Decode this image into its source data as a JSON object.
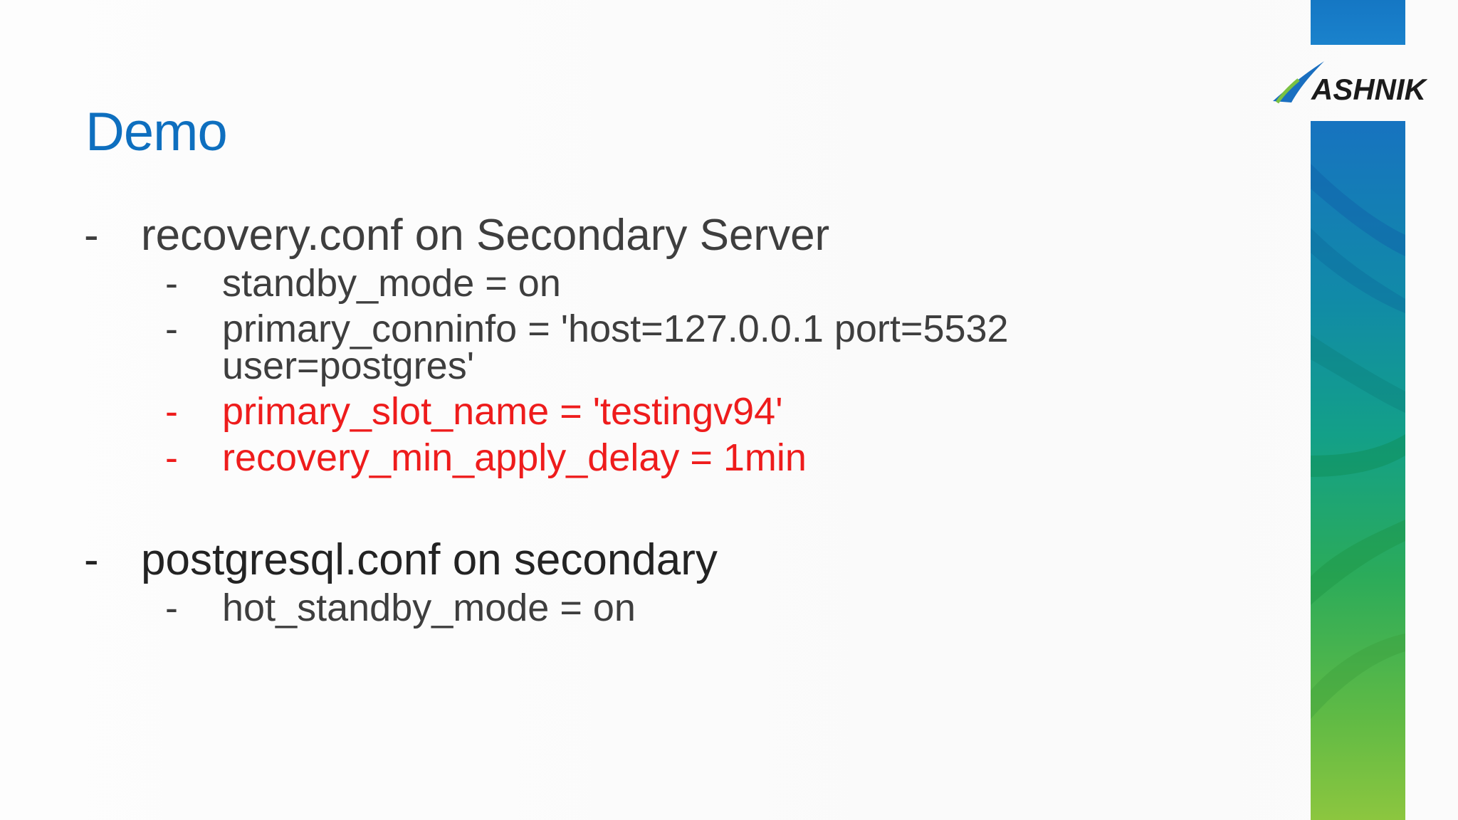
{
  "slide": {
    "title": "Demo",
    "logo_text": "ASHNIK",
    "colors": {
      "title": "#0e6fbf",
      "body_text": "#3e3e3e",
      "highlight": "#ee1c1c",
      "stripe_blue": "#1577c4",
      "stripe_green": "#8cc63f"
    },
    "bullets": [
      {
        "dash": "-",
        "text": "recovery.conf on Secondary Server",
        "children": [
          {
            "dash": "-",
            "text": "standby_mode = on"
          },
          {
            "dash": "-",
            "text": "primary_conninfo = 'host=127.0.0.1 port=5532",
            "text_cont": "user=postgres'"
          },
          {
            "dash": "-",
            "text": "primary_slot_name = 'testingv94'",
            "highlight": true
          },
          {
            "dash": "-",
            "text": "recovery_min_apply_delay = 1min",
            "highlight": true
          }
        ]
      },
      {
        "dash": "-",
        "text": "postgresql.conf on secondary",
        "children": [
          {
            "dash": "-",
            "text": "hot_standby_mode = on"
          }
        ]
      }
    ]
  }
}
